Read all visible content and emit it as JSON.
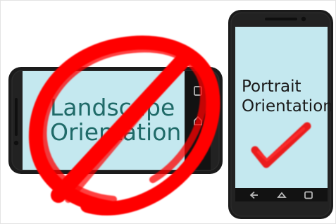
{
  "landscape": {
    "line1": "Landscape",
    "line2": "Orientation"
  },
  "portrait": {
    "line1": "Portrait",
    "line2": "Orientation"
  },
  "colors": {
    "screen": "#c4e8ef",
    "phone_body": "#1b1b1b",
    "phone_edge": "#2b2b2b",
    "prohibit_red": "#ff0000",
    "check_red": "#ea1b1b",
    "landscape_text": "#1f6a68",
    "portrait_text": "#1a1a1a",
    "nav_icon": "#bdbdbd"
  },
  "icons": [
    "back-icon",
    "home-icon",
    "recent-apps-icon",
    "prohibited-icon",
    "checkmark-icon"
  ]
}
